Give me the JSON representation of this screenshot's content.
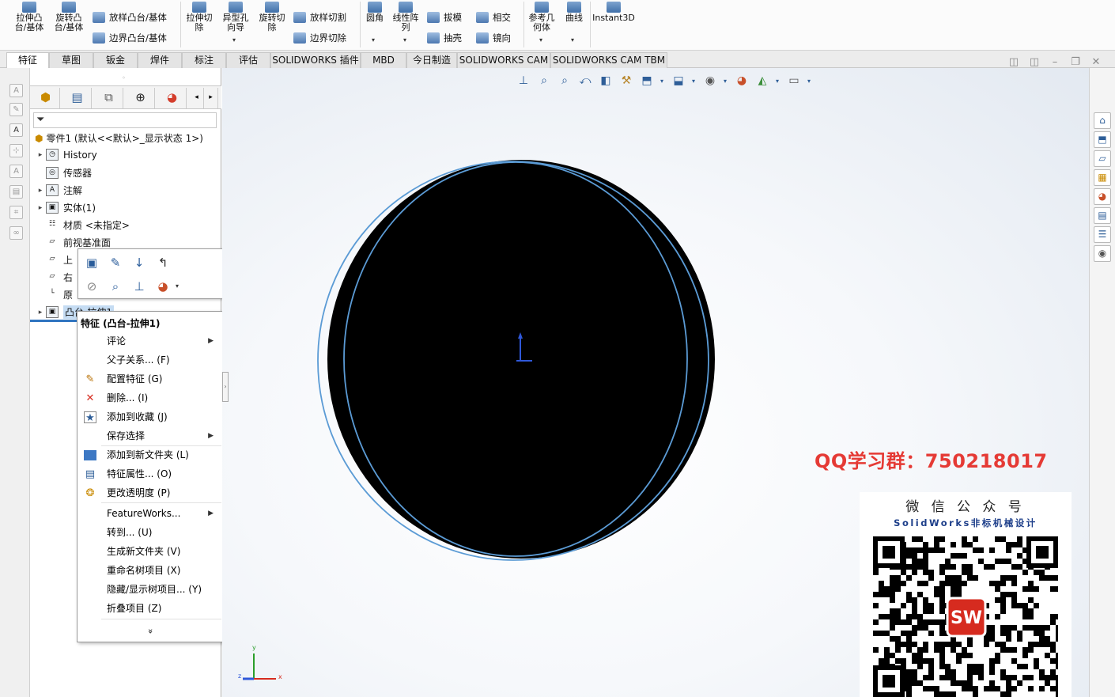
{
  "ribbon": {
    "buttons": [
      {
        "label1": "拉伸凸",
        "label2": "台/基体"
      },
      {
        "label1": "旋转凸",
        "label2": "台/基体"
      },
      {
        "label1": "拉伸切",
        "label2": "除"
      },
      {
        "label1": "异型孔",
        "label2": "向导"
      },
      {
        "label1": "旋转切",
        "label2": "除"
      },
      {
        "label1": "圆角",
        "label2": ""
      },
      {
        "label1": "线性阵",
        "label2": "列"
      },
      {
        "label1": "参考几",
        "label2": "何体"
      },
      {
        "label1": "曲线",
        "label2": ""
      },
      {
        "label1": "Instant3D",
        "label2": ""
      }
    ],
    "small": [
      "放样凸台/基体",
      "边界凸台/基体",
      "放样切割",
      "边界切除",
      "拔模",
      "抽壳",
      "相交",
      "镜向"
    ]
  },
  "tabs": [
    "特征",
    "草图",
    "钣金",
    "焊件",
    "标注",
    "评估",
    "SOLIDWORKS 插件",
    "MBD",
    "今日制造",
    "SOLIDWORKS CAM",
    "SOLIDWORKS CAM TBM"
  ],
  "active_tab": "特征",
  "tree": {
    "root": "零件1  (默认<<默认>_显示状态 1>)",
    "items": [
      "History",
      "传感器",
      "注解",
      "实体(1)",
      "材质 <未指定>",
      "前视基准面",
      "上",
      "右",
      "原",
      "凸台-拉伸1"
    ]
  },
  "context_menu": {
    "header": "特征 (凸台-拉伸1)",
    "items": [
      {
        "label": "评论",
        "submenu": true,
        "icon": ""
      },
      {
        "label": "父子关系... (F)",
        "submenu": false,
        "icon": ""
      },
      {
        "label": "配置特征 (G)",
        "submenu": false,
        "icon": "pencil-icon"
      },
      {
        "label": "删除... (I)",
        "submenu": false,
        "icon": "delete-x-icon"
      },
      {
        "label": "添加到收藏 (J)",
        "submenu": false,
        "icon": "star-icon"
      },
      {
        "label": "保存选择",
        "submenu": true,
        "icon": ""
      },
      {
        "label": "添加到新文件夹 (L)",
        "submenu": false,
        "icon": "folder-icon"
      },
      {
        "label": "特征属性... (O)",
        "submenu": false,
        "icon": "properties-icon"
      },
      {
        "label": "更改透明度 (P)",
        "submenu": false,
        "icon": "transparency-icon"
      },
      {
        "label": "FeatureWorks...",
        "submenu": true,
        "icon": ""
      },
      {
        "label": "转到... (U)",
        "submenu": false,
        "icon": ""
      },
      {
        "label": "生成新文件夹 (V)",
        "submenu": false,
        "icon": ""
      },
      {
        "label": "重命名树项目 (X)",
        "submenu": false,
        "icon": ""
      },
      {
        "label": "隐藏/显示树项目... (Y)",
        "submenu": false,
        "icon": ""
      },
      {
        "label": "折叠项目 (Z)",
        "submenu": false,
        "icon": ""
      }
    ],
    "more": "»"
  },
  "viewport": {
    "axis_labels": {
      "x": "x",
      "y": "y",
      "z": "z"
    },
    "body_color": "#000000",
    "edge_color": "#5b9bd5"
  },
  "watermark": {
    "qq": "QQ学习群：750218017",
    "wechat_title": "微 信 公 众 号",
    "wechat_sub": "SolidWorks非标机械设计",
    "logo_text": "SW"
  },
  "colors": {
    "accent": "#2e5e98",
    "qq_red": "#e53a35"
  }
}
